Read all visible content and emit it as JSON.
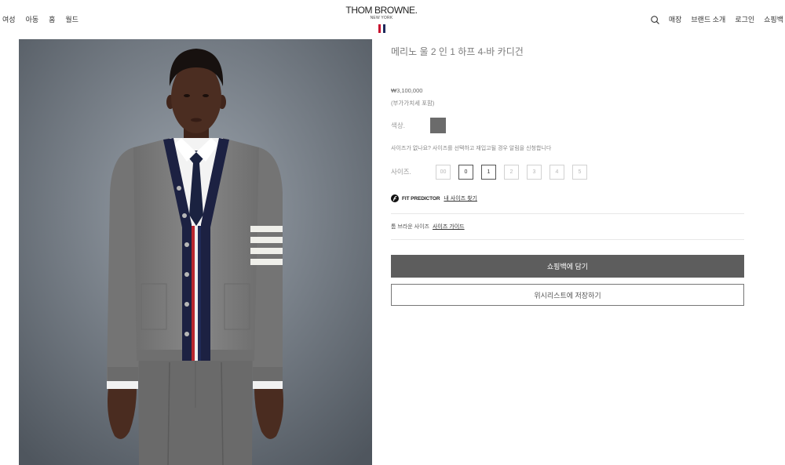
{
  "theme": {
    "text": "#444444",
    "muted": "#999999",
    "divider": "#e8e8e8",
    "button_dark": "#5d5d5d",
    "button_border": "#777777",
    "flag_colors": [
      "#c8102e",
      "#ffffff",
      "#1f2a5c"
    ]
  },
  "header": {
    "nav_left": [
      "여성",
      "아동",
      "홈",
      "월드"
    ],
    "brand_name": "THOM BROWNE.",
    "brand_city": "NEW YORK",
    "flag_icon": "brand-flag-icon",
    "search_icon": "search-icon",
    "nav_right": [
      "매장",
      "브랜드 소개",
      "로그인",
      "쇼핑백"
    ]
  },
  "product": {
    "title": "메리노 울 2 인 1 하프 4-바 카디건",
    "price": "₩3,100,000",
    "tax_note": "(부가가치세 포함)",
    "color": {
      "label": "색상.",
      "swatch": "#6b6b6b",
      "selected": true
    },
    "size_notice": "사이즈가 없나요? 사이즈를 선택하고 재입고될 경우 알림을 신청합니다",
    "size": {
      "label": "사이즈.",
      "options": [
        {
          "label": "00",
          "available": false
        },
        {
          "label": "0",
          "available": true
        },
        {
          "label": "1",
          "available": true
        },
        {
          "label": "2",
          "available": false
        },
        {
          "label": "3",
          "available": false
        },
        {
          "label": "4",
          "available": false
        },
        {
          "label": "5",
          "available": false
        }
      ]
    },
    "fit_predictor": {
      "icon": "fit-predictor-logo-icon",
      "label": "FIT PREDICTOR",
      "link": "내 사이즈 찾기"
    },
    "size_guide": {
      "prefix": "톰 브라운 사이즈",
      "link": "사이즈 가이드"
    },
    "actions": {
      "add_to_bag": "쇼핑백에 담기",
      "wishlist": "위시리스트에 저장하기"
    }
  }
}
